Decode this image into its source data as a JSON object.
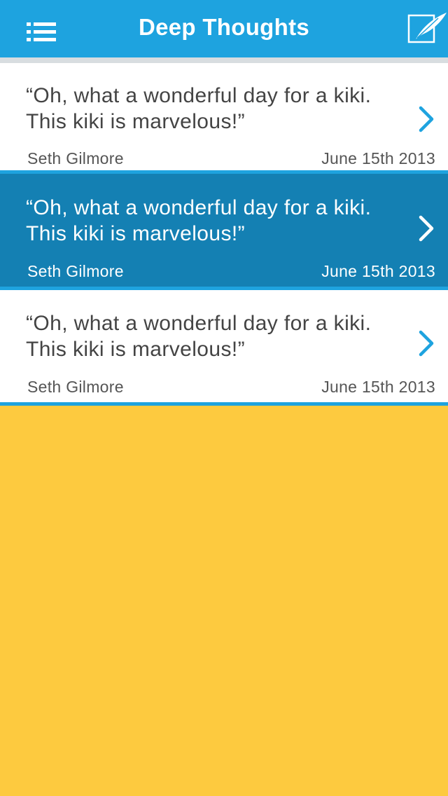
{
  "navbar": {
    "title": "Deep Thoughts",
    "background": "#1EA3DF",
    "menu_icon": "hamburger-menu-icon",
    "compose_icon": "quill-compose-icon"
  },
  "thoughts": [
    {
      "quote": "“Oh, what a wonderful day for a kiki.  This kiki is marvelous!”",
      "author": "Seth Gilmore",
      "date": "June 15th 2013",
      "selected": false
    },
    {
      "quote": "“Oh, what a wonderful day for a kiki.  This kiki is marvelous!”",
      "author": "Seth Gilmore",
      "date": "June 15th 2013",
      "selected": true
    },
    {
      "quote": "“Oh, what a wonderful day for a kiki.  This kiki is marvelous!”",
      "author": "Seth Gilmore",
      "date": "June 15th 2013",
      "selected": false
    }
  ],
  "colors": {
    "accent": "#1EA3DF",
    "selected_row": "#1480B3",
    "background": "#FDCA3F",
    "chevron": "#1EA3DF"
  }
}
